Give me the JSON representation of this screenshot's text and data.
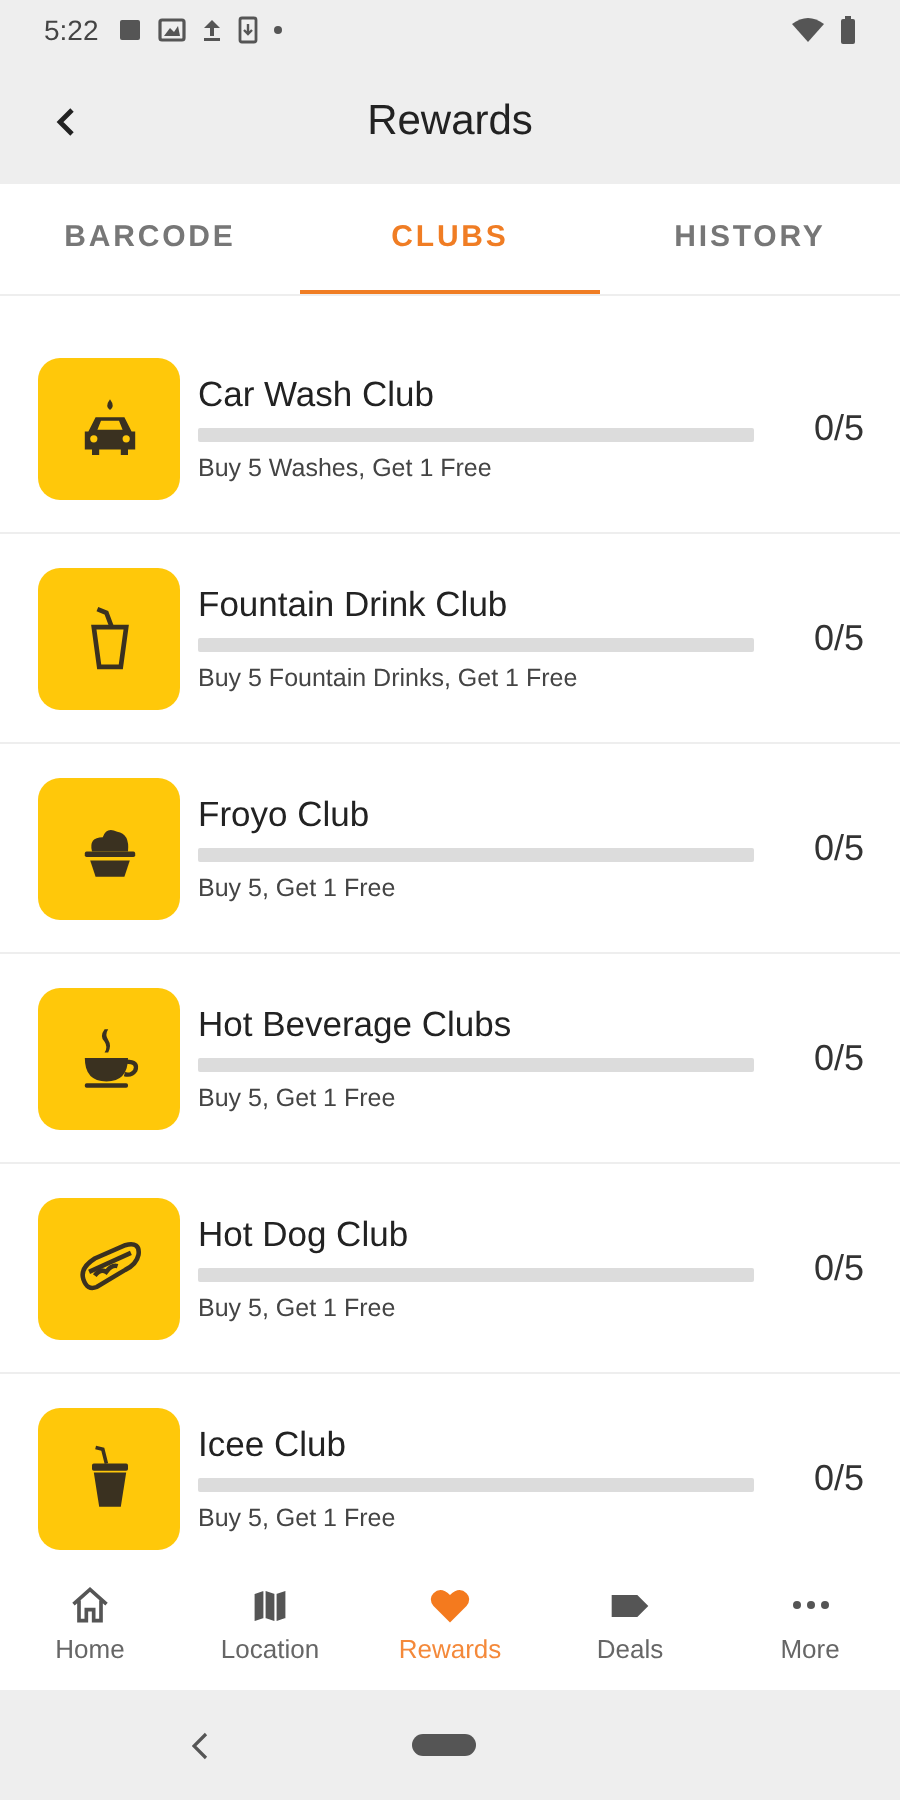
{
  "status_bar": {
    "time": "5:22"
  },
  "toolbar": {
    "title": "Rewards"
  },
  "tabs": [
    {
      "label": "BARCODE",
      "selected": false
    },
    {
      "label": "CLUBS",
      "selected": true
    },
    {
      "label": "HISTORY",
      "selected": false
    }
  ],
  "clubs": [
    {
      "kind": "car",
      "name": "Car Wash Club",
      "level": 0,
      "count": "0/5",
      "terms": "Buy 5 Washes, Get 1 Free"
    },
    {
      "kind": "drink",
      "name": "Fountain Drink Club",
      "level": 0,
      "count": "0/5",
      "terms": "Buy 5 Fountain Drinks, Get 1 Free"
    },
    {
      "kind": "froyo",
      "name": "Froyo Club",
      "level": 0,
      "count": "0/5",
      "terms": "Buy 5, Get 1 Free"
    },
    {
      "kind": "coffee",
      "name": "Hot Beverage Clubs",
      "level": 0,
      "count": "0/5",
      "terms": "Buy 5, Get 1 Free"
    },
    {
      "kind": "hotdog",
      "name": "Hot Dog Club",
      "level": 0,
      "count": "0/5",
      "terms": "Buy 5, Get 1 Free"
    },
    {
      "kind": "icee",
      "name": "Icee Club",
      "level": 0,
      "count": "0/5",
      "terms": "Buy 5, Get 1 Free"
    }
  ],
  "bottom_nav": [
    {
      "kind": "home",
      "label": "Home",
      "selected": false
    },
    {
      "kind": "location",
      "label": "Location",
      "selected": false
    },
    {
      "kind": "rewards",
      "label": "Rewards",
      "selected": true
    },
    {
      "kind": "deals",
      "label": "Deals",
      "selected": false
    },
    {
      "kind": "more",
      "label": "More",
      "selected": false
    }
  ]
}
